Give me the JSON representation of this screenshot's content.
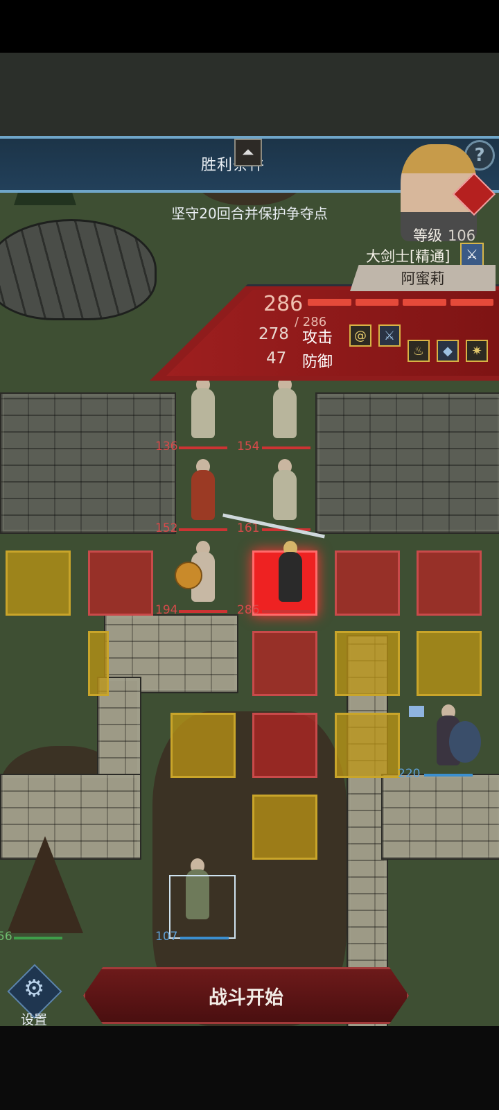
{
  "banner": {
    "title": "胜利条件",
    "toggle_glyph": "⏶",
    "objective": "坚守20回合并保护争夺点",
    "help_glyph": "?"
  },
  "hero": {
    "level_label": "等级",
    "level": "106",
    "class_label": "大剑士[精通]",
    "name": "阿蜜莉",
    "hp_current": "286",
    "hp_max": "/ 286",
    "attack_value": "278",
    "attack_label": "攻击",
    "defense_value": "47",
    "defense_label": "防御"
  },
  "skills": [
    "spiral-skill-icon",
    "sword-skill-icon",
    "fire-skill-icon",
    "crystal-skill-icon",
    "burst-skill-icon"
  ],
  "units": {
    "enemy_1_hp": "136",
    "enemy_2_hp": "154",
    "enemy_3_hp": "152",
    "enemy_4_hp": "161",
    "enemy_5_hp": "194",
    "hero_hp": "286",
    "ally_knight_hp": "220",
    "ally_archer_hp": "107",
    "ally_left_hp": "56"
  },
  "controls": {
    "start_label": "战斗开始",
    "settings_label": "设置"
  },
  "colors": {
    "danger_tile": "#be2323",
    "move_tile": "#be9614",
    "panel_red": "#8f1c1c",
    "banner_blue": "#22405a"
  }
}
